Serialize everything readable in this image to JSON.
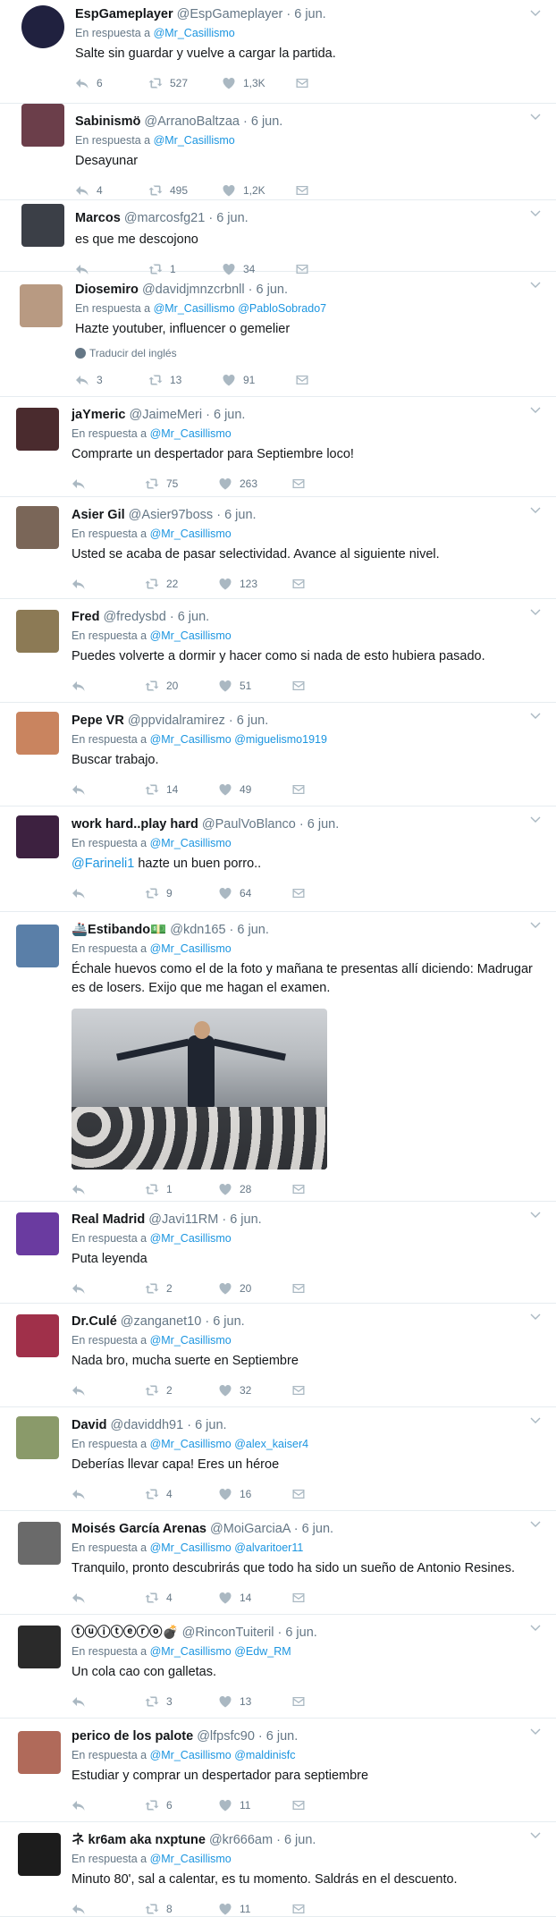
{
  "tweets": [
    {
      "name": "EspGameplayer",
      "handle": "@EspGameplayer",
      "time": "6 jun.",
      "reply_prefix": "En respuesta a",
      "reply_to": [
        "@Mr_Casillismo"
      ],
      "text": "Salte sin guardar y vuelve a cargar la partida.",
      "replies": "6",
      "retweets": "527",
      "likes": "1,3K",
      "avatar_color": "#20213f"
    },
    {
      "name": "Sabinismö",
      "handle": "@ArranoBaltzaa",
      "time": "6 jun.",
      "reply_prefix": "En respuesta a",
      "reply_to": [
        "@Mr_Casillismo"
      ],
      "text": "Desayunar",
      "replies": "4",
      "retweets": "495",
      "likes": "1,2K",
      "avatar_color": "#6b3e4a"
    },
    {
      "name": "Marcos",
      "handle": "@marcosfg21",
      "time": "6 jun.",
      "reply_prefix": "",
      "reply_to": [],
      "text": "es que me descojono",
      "replies": "",
      "retweets": "1",
      "likes": "34",
      "avatar_color": "#3b3f47"
    },
    {
      "name": "Diosemiro",
      "handle": "@davidjmnzcrbnll",
      "time": "6 jun.",
      "reply_prefix": "En respuesta a",
      "reply_to": [
        "@Mr_Casillismo",
        "@PabloSobrado7"
      ],
      "text": "Hazte youtuber, influencer o gemelier",
      "translate": "Traducir del inglés",
      "replies": "3",
      "retweets": "13",
      "likes": "91",
      "avatar_color": "#b89a82"
    },
    {
      "name": "jaYmeric",
      "handle": "@JaimeMeri",
      "time": "6 jun.",
      "reply_prefix": "En respuesta a",
      "reply_to": [
        "@Mr_Casillismo"
      ],
      "text": "Comprarte un despertador para Septiembre loco!",
      "replies": "",
      "retweets": "75",
      "likes": "263",
      "avatar_color": "#4a2b2e"
    },
    {
      "name": "Asier Gil",
      "handle": "@Asier97boss",
      "time": "6 jun.",
      "reply_prefix": "En respuesta a",
      "reply_to": [
        "@Mr_Casillismo"
      ],
      "text": "Usted se acaba de pasar selectividad. Avance al siguiente nivel.",
      "replies": "",
      "retweets": "22",
      "likes": "123",
      "avatar_color": "#7a6658"
    },
    {
      "name": "Fred",
      "handle": "@fredysbd",
      "time": "6 jun.",
      "reply_prefix": "En respuesta a",
      "reply_to": [
        "@Mr_Casillismo"
      ],
      "text": "Puedes volverte a dormir y hacer como si nada de esto hubiera pasado.",
      "replies": "",
      "retweets": "20",
      "likes": "51",
      "avatar_color": "#8c7a55"
    },
    {
      "name": "Pepe VR",
      "handle": "@ppvidalramirez",
      "time": "6 jun.",
      "reply_prefix": "En respuesta a",
      "reply_to": [
        "@Mr_Casillismo",
        "@miguelismo1919"
      ],
      "text": "Buscar trabajo.",
      "replies": "",
      "retweets": "14",
      "likes": "49",
      "avatar_color": "#c9845f"
    },
    {
      "name": "work hard..play hard",
      "handle": "@PaulVoBlanco",
      "time": "6 jun.",
      "reply_prefix": "En respuesta a",
      "reply_to": [
        "@Mr_Casillismo"
      ],
      "text_mention": "@Farineli1",
      "text": "hazte un buen porro..",
      "replies": "",
      "retweets": "9",
      "likes": "64",
      "avatar_color": "#3d2140"
    },
    {
      "name": "🚢Estibando💵",
      "handle": "@kdn165",
      "time": "6 jun.",
      "reply_prefix": "En respuesta a",
      "reply_to": [
        "@Mr_Casillismo"
      ],
      "text": "Échale huevos como el de la foto y mañana te presentas allí diciendo: Madrugar es de losers. Exijo que me hagan el examen.",
      "replies": "",
      "retweets": "1",
      "likes": "28",
      "avatar_color": "#5a7fa8",
      "has_media": true
    },
    {
      "name": "Real Madrid",
      "handle": "@Javi11RM",
      "time": "6 jun.",
      "reply_prefix": "En respuesta a",
      "reply_to": [
        "@Mr_Casillismo"
      ],
      "text": "Puta leyenda",
      "replies": "",
      "retweets": "2",
      "likes": "20",
      "avatar_color": "#6a3ba0"
    },
    {
      "name": "Dr.Culé",
      "handle": "@zanganet10",
      "time": "6 jun.",
      "reply_prefix": "En respuesta a",
      "reply_to": [
        "@Mr_Casillismo"
      ],
      "text": "Nada bro, mucha suerte en Septiembre",
      "replies": "",
      "retweets": "2",
      "likes": "32",
      "avatar_color": "#a0304a"
    },
    {
      "name": "David",
      "handle": "@daviddh91",
      "time": "6 jun.",
      "reply_prefix": "En respuesta a",
      "reply_to": [
        "@Mr_Casillismo",
        "@alex_kaiser4"
      ],
      "text": "Deberías llevar capa! Eres un héroe",
      "replies": "",
      "retweets": "4",
      "likes": "16",
      "avatar_color": "#8a9a6a"
    },
    {
      "name": "Moisés García Arenas",
      "handle": "@MoiGarciaA",
      "time": "6 jun.",
      "reply_prefix": "En respuesta a",
      "reply_to": [
        "@Mr_Casillismo",
        "@alvaritoer11"
      ],
      "text": "Tranquilo, pronto descubrirás que todo ha sido un sueño de Antonio Resines.",
      "replies": "",
      "retweets": "4",
      "likes": "14",
      "avatar_color": "#6a6a6a"
    },
    {
      "name": "ⓣⓤⓘⓣⓔⓡⓞ💣",
      "handle": "@RinconTuiteril",
      "time": "6 jun.",
      "reply_prefix": "En respuesta a",
      "reply_to": [
        "@Mr_Casillismo",
        "@Edw_RM"
      ],
      "text": "Un cola cao con galletas.",
      "replies": "",
      "retweets": "3",
      "likes": "13",
      "avatar_color": "#2a2a2a"
    },
    {
      "name": "perico de los palote",
      "handle": "@lfpsfc90",
      "time": "6 jun.",
      "reply_prefix": "En respuesta a",
      "reply_to": [
        "@Mr_Casillismo",
        "@maldinisfc"
      ],
      "text": "Estudiar y comprar un despertador para septiembre",
      "replies": "",
      "retweets": "6",
      "likes": "11",
      "avatar_color": "#b06a5a"
    },
    {
      "name": "ネ kr6am aka nxptune",
      "handle": "@kr666am",
      "time": "6 jun.",
      "reply_prefix": "En respuesta a",
      "reply_to": [
        "@Mr_Casillismo"
      ],
      "text": "Minuto 80', sal a calentar, es tu momento. Saldrás en el descuento.",
      "replies": "",
      "retweets": "8",
      "likes": "11",
      "avatar_color": "#1c1c1c"
    }
  ]
}
